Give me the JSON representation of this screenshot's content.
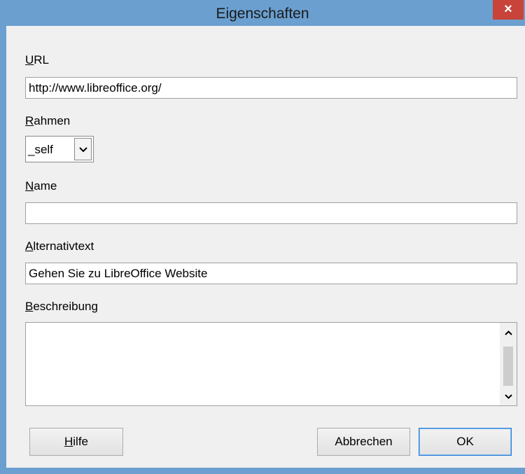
{
  "dialog": {
    "title": "Eigenschaften",
    "close_glyph": "×"
  },
  "url": {
    "label": "URL",
    "accesskey": "U",
    "rest": "RL",
    "value": "http://www.libreoffice.org/"
  },
  "frame": {
    "label": "Rahmen",
    "accesskey": "R",
    "rest": "ahmen",
    "value": "_self",
    "dropdown_glyph": "⌄"
  },
  "name": {
    "label": "Name",
    "accesskey": "N",
    "rest": "ame",
    "value": ""
  },
  "alt_text": {
    "label": "Alternativtext",
    "accesskey": "A",
    "rest": "lternativtext",
    "value": "Gehen Sie zu LibreOffice Website"
  },
  "description": {
    "label": "Beschreibung",
    "accesskey": "B",
    "rest": "eschreibung",
    "value": "",
    "scroll_up_glyph": "˄",
    "scroll_down_glyph": "˅"
  },
  "buttons": {
    "help": {
      "label": "Hilfe",
      "accesskey": "H",
      "rest": "ilfe"
    },
    "cancel": {
      "label": "Abbrechen"
    },
    "ok": {
      "label": "OK"
    }
  },
  "colors": {
    "titlebar": "#6a9fd0",
    "close_button": "#c8433a",
    "dialog_background": "#f0f0f0",
    "default_button_border": "#2e7fd6"
  }
}
